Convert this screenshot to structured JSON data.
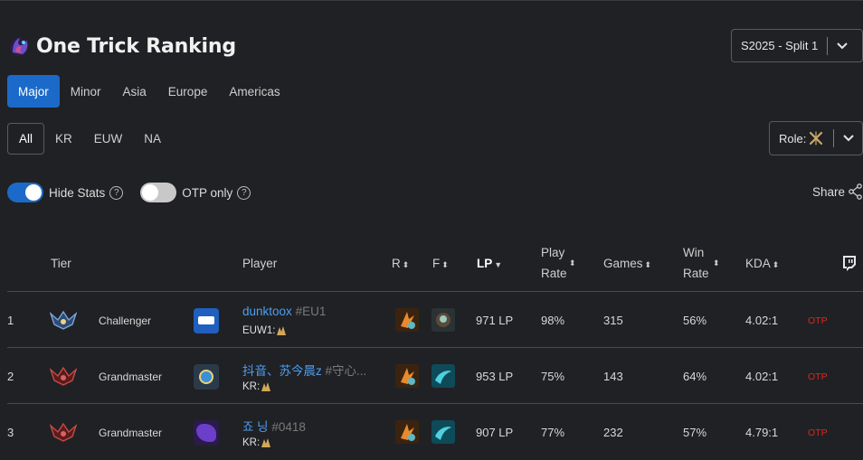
{
  "page": {
    "title": "One Trick Ranking"
  },
  "season_select": {
    "value": "S2025 - Split 1"
  },
  "league_tabs": [
    {
      "label": "Major",
      "active": true
    },
    {
      "label": "Minor",
      "active": false
    },
    {
      "label": "Asia",
      "active": false
    },
    {
      "label": "Europe",
      "active": false
    },
    {
      "label": "Americas",
      "active": false
    }
  ],
  "region_tabs": [
    {
      "label": "All",
      "active": true
    },
    {
      "label": "KR",
      "active": false
    },
    {
      "label": "EUW",
      "active": false
    },
    {
      "label": "NA",
      "active": false
    }
  ],
  "role_select": {
    "label": "Role:"
  },
  "toggles": {
    "hide_stats": {
      "label": "Hide Stats",
      "on": true
    },
    "otp_only": {
      "label": "OTP only",
      "on": false
    }
  },
  "share": {
    "label": "Share"
  },
  "table": {
    "headers": {
      "tier": "Tier",
      "player": "Player",
      "r": "R",
      "f": "F",
      "lp": "LP",
      "play_rate_1": "Play",
      "play_rate_2": "Rate",
      "games": "Games",
      "win_rate_1": "Win",
      "win_rate_2": "Rate",
      "kda": "KDA"
    },
    "rows": [
      {
        "rank": "1",
        "tier": "Challenger",
        "tier_color": "#7aa6d8",
        "name": "dunktoox",
        "tag": "#EU1",
        "region": "EUW1:",
        "lp": "971 LP",
        "play_rate": "98%",
        "games": "315",
        "win_rate": "56%",
        "kda": "4.02:1",
        "otp": "OTP"
      },
      {
        "rank": "2",
        "tier": "Grandmaster",
        "tier_color": "#c44a4a",
        "name": "抖音、苏今晨z",
        "tag": "#守心...",
        "region": "KR:",
        "lp": "953 LP",
        "play_rate": "75%",
        "games": "143",
        "win_rate": "64%",
        "kda": "4.02:1",
        "otp": "OTP"
      },
      {
        "rank": "3",
        "tier": "Grandmaster",
        "tier_color": "#c44a4a",
        "name": "죠 닝",
        "tag": "#0418",
        "region": "KR:",
        "lp": "907 LP",
        "play_rate": "77%",
        "games": "232",
        "win_rate": "57%",
        "kda": "4.79:1",
        "otp": "OTP"
      }
    ]
  },
  "colors": {
    "accent": "#1b6ac9",
    "link": "#4e9ff0",
    "otp": "#e2261c",
    "background": "#202124"
  },
  "icons": [
    "champion-logo-icon",
    "chevron-down-icon",
    "help-icon",
    "share-icon",
    "twitch-icon",
    "sort-icon",
    "tier-emblem-icon",
    "summoner-spell-icon"
  ]
}
